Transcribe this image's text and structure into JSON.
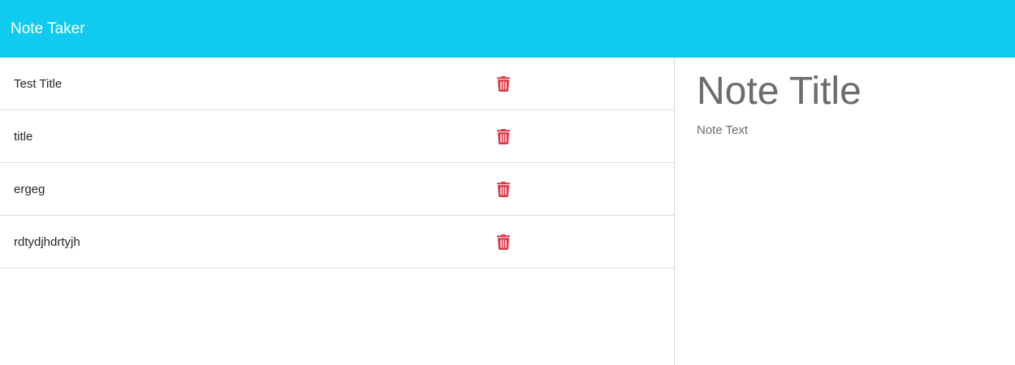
{
  "navbar": {
    "brand": "Note Taker"
  },
  "notes": [
    {
      "title": "Test Title"
    },
    {
      "title": "title"
    },
    {
      "title": "ergeg"
    },
    {
      "title": "rdtydjhdrtyjh"
    }
  ],
  "editor": {
    "title_placeholder": "Note Title",
    "text_placeholder": "Note Text"
  },
  "colors": {
    "navbar_bg": "#0fcbef",
    "delete_icon": "#dc3545"
  },
  "icons": {
    "delete": "trash-icon"
  }
}
